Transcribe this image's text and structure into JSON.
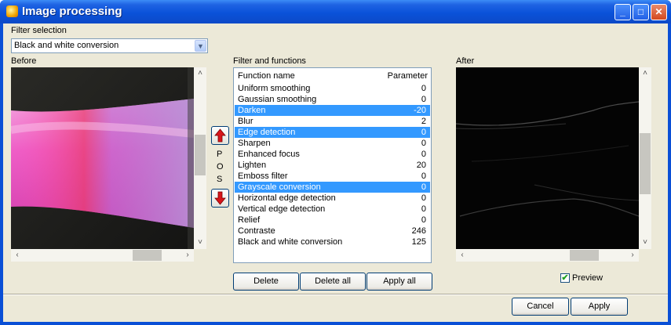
{
  "window": {
    "title": "Image processing",
    "icon": "sun-app-icon"
  },
  "controls": {
    "minimize": "_",
    "maximize": "□",
    "close": "✕"
  },
  "filter_selection": {
    "label": "Filter selection",
    "value": "Black and white conversion"
  },
  "before": {
    "label": "Before"
  },
  "after": {
    "label": "After"
  },
  "list": {
    "label": "Filter and functions",
    "col_name": "Function name",
    "col_param": "Parameter",
    "rows": [
      {
        "name": "Uniform smoothing",
        "param": "0",
        "selected": false
      },
      {
        "name": "Gaussian smoothing",
        "param": "0",
        "selected": false
      },
      {
        "name": "Darken",
        "param": "-20",
        "selected": true
      },
      {
        "name": "Blur",
        "param": "2",
        "selected": false
      },
      {
        "name": "Edge detection",
        "param": "0",
        "selected": true
      },
      {
        "name": "Sharpen",
        "param": "0",
        "selected": false
      },
      {
        "name": "Enhanced focus",
        "param": "0",
        "selected": false
      },
      {
        "name": "Lighten",
        "param": "20",
        "selected": false
      },
      {
        "name": "Emboss filter",
        "param": "0",
        "selected": false
      },
      {
        "name": "Grayscale conversion",
        "param": "0",
        "selected": true
      },
      {
        "name": "Horizontal edge detection",
        "param": "0",
        "selected": false
      },
      {
        "name": "Vertical edge detection",
        "param": "0",
        "selected": false
      },
      {
        "name": "Relief",
        "param": "0",
        "selected": false
      },
      {
        "name": "Contraste",
        "param": "246",
        "selected": false
      },
      {
        "name": "Black and white conversion",
        "param": "125",
        "selected": false
      }
    ]
  },
  "pos": {
    "letters": [
      "P",
      "O",
      "S"
    ]
  },
  "buttons": {
    "delete": "Delete",
    "delete_all": "Delete all",
    "apply_all": "Apply all",
    "cancel": "Cancel",
    "apply": "Apply"
  },
  "preview": {
    "label": "Preview",
    "checked": true
  },
  "colors": {
    "selection": "#3399ff",
    "title_blue": "#0a52d9",
    "face": "#ece9d8"
  }
}
